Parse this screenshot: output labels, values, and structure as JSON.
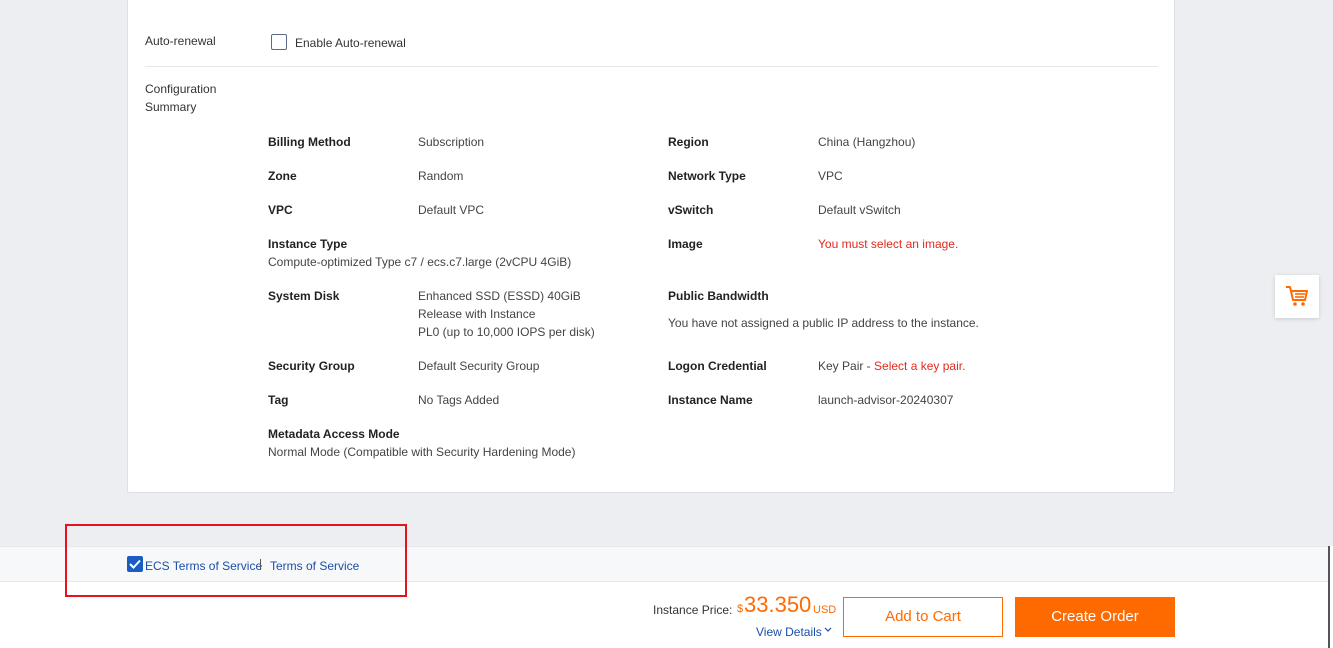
{
  "auto_renewal": {
    "label": "Auto-renewal",
    "checkbox_label": "Enable Auto-renewal",
    "checked": false
  },
  "summary": {
    "section_label": "Configuration Summary",
    "billing_method": {
      "key": "Billing Method",
      "value": "Subscription"
    },
    "region": {
      "key": "Region",
      "value": "China (Hangzhou)"
    },
    "zone": {
      "key": "Zone",
      "value": "Random"
    },
    "network_type": {
      "key": "Network Type",
      "value": "VPC"
    },
    "vpc": {
      "key": "VPC",
      "value": "Default VPC"
    },
    "vswitch": {
      "key": "vSwitch",
      "value": "Default vSwitch"
    },
    "instance_type": {
      "key": "Instance Type",
      "value": "Compute-optimized Type c7 / ecs.c7.large (2vCPU 4GiB)"
    },
    "image": {
      "key": "Image",
      "value": "You must select an image."
    },
    "system_disk": {
      "key": "System Disk",
      "line1": "Enhanced SSD (ESSD) 40GiB",
      "line2": "Release with Instance",
      "line3": "PL0 (up to 10,000 IOPS per disk)"
    },
    "public_bandwidth": {
      "key": "Public Bandwidth",
      "value": "You have not assigned a public IP address to the instance."
    },
    "security_group": {
      "key": "Security Group",
      "value": "Default Security Group"
    },
    "logon_credential": {
      "key": "Logon Credential",
      "value_prefix": "Key Pair - ",
      "value_error": "Select a key pair."
    },
    "tag": {
      "key": "Tag",
      "value": "No Tags Added"
    },
    "instance_name": {
      "key": "Instance Name",
      "value": "launch-advisor-20240307"
    },
    "metadata_access_mode": {
      "key": "Metadata Access Mode",
      "value": "Normal Mode (Compatible with Security Hardening Mode)"
    }
  },
  "terms": {
    "checked": true,
    "link1": "ECS Terms of Service",
    "link2": "Terms of Service"
  },
  "footer": {
    "price_label": "Instance Price:",
    "currency_symbol": "$",
    "price_amount": "33.350",
    "price_unit": "USD",
    "view_details": "View Details",
    "add_to_cart": "Add to Cart",
    "create_order": "Create Order"
  },
  "colors": {
    "accent_orange": "#ff6a00",
    "link_blue": "#1a4fa8",
    "error_red": "#e02b20",
    "highlight_red": "#e3141b"
  },
  "icons": {
    "floating_cart": "shopping-cart-icon",
    "view_details_chevron": "chevron-down-icon",
    "terms_check": "checkmark-icon"
  }
}
